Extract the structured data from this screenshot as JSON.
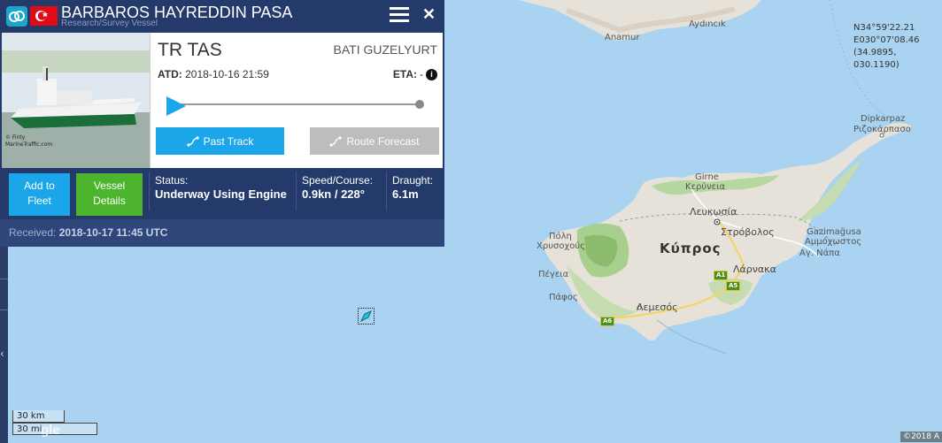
{
  "vessel": {
    "name": "BARBAROS HAYREDDIN PASA",
    "type": "Research/Survey Vessel",
    "flag_icon": "turkey-flag-icon",
    "photo_credit_line1": "© Finty",
    "photo_credit_line2": "MarineTraffic.com"
  },
  "voyage": {
    "destination_code": "TR TAS",
    "destination_name": "BATI GUZELYURT",
    "atd_label": "ATD:",
    "atd_value": "2018-10-16 21:59",
    "eta_label": "ETA:",
    "eta_value": "-",
    "progress": 0
  },
  "actions": {
    "past_track": "Past Track",
    "route_forecast": "Route Forecast",
    "add_to_fleet_line1": "Add to",
    "add_to_fleet_line2": "Fleet",
    "vessel_details_line1": "Vessel",
    "vessel_details_line2": "Details"
  },
  "status": {
    "status_label": "Status:",
    "status_value": "Underway Using Engine",
    "speed_label": "Speed/Course:",
    "speed_value": "0.9kn / 228°",
    "draught_label": "Draught:",
    "draught_value": "6.1m"
  },
  "received": {
    "label": "Received:",
    "value": "2018-10-17 11:45 UTC"
  },
  "map": {
    "coords_line1": "N34°59'22.21",
    "coords_line2": "E030°07'08.46",
    "coords_line3": "(34.9895, 030.1190)",
    "labels": {
      "anamur": "Anamur",
      "aydincik": "Aydıncık",
      "dipkarpaz1": "Dipkarpaz",
      "dipkarpaz2": "Ριζοκάρπασο",
      "girne1": "Girne",
      "girne2": "Κερύνεια",
      "lefkosia": "Λευκωσία",
      "strovolos": "Στρόβολος",
      "gazimagusa1": "Gazimağusa",
      "gazimagusa2": "Αμμόχωστος",
      "agnapa": "Αγ. Νάπα",
      "polis1": "Πόλη",
      "polis2": "Χρυσοχούς",
      "kypros": "Κύπρος",
      "larnaka": "Λάρνακα",
      "pegeia": "Πέγεια",
      "pafos": "Πάφος",
      "lemesos": "Λεμεσός"
    },
    "roads": {
      "a1": "A1",
      "a5": "A5",
      "a6": "A6"
    },
    "scale_km": "30 km",
    "scale_mi": "30 mi",
    "google": "gle",
    "copyright": "©2018 A"
  },
  "colors": {
    "sea": "#a9d3f0",
    "land": "#e6e2da",
    "panel": "#233a6b",
    "accent": "#1aa6e8",
    "green": "#4cb52d"
  }
}
